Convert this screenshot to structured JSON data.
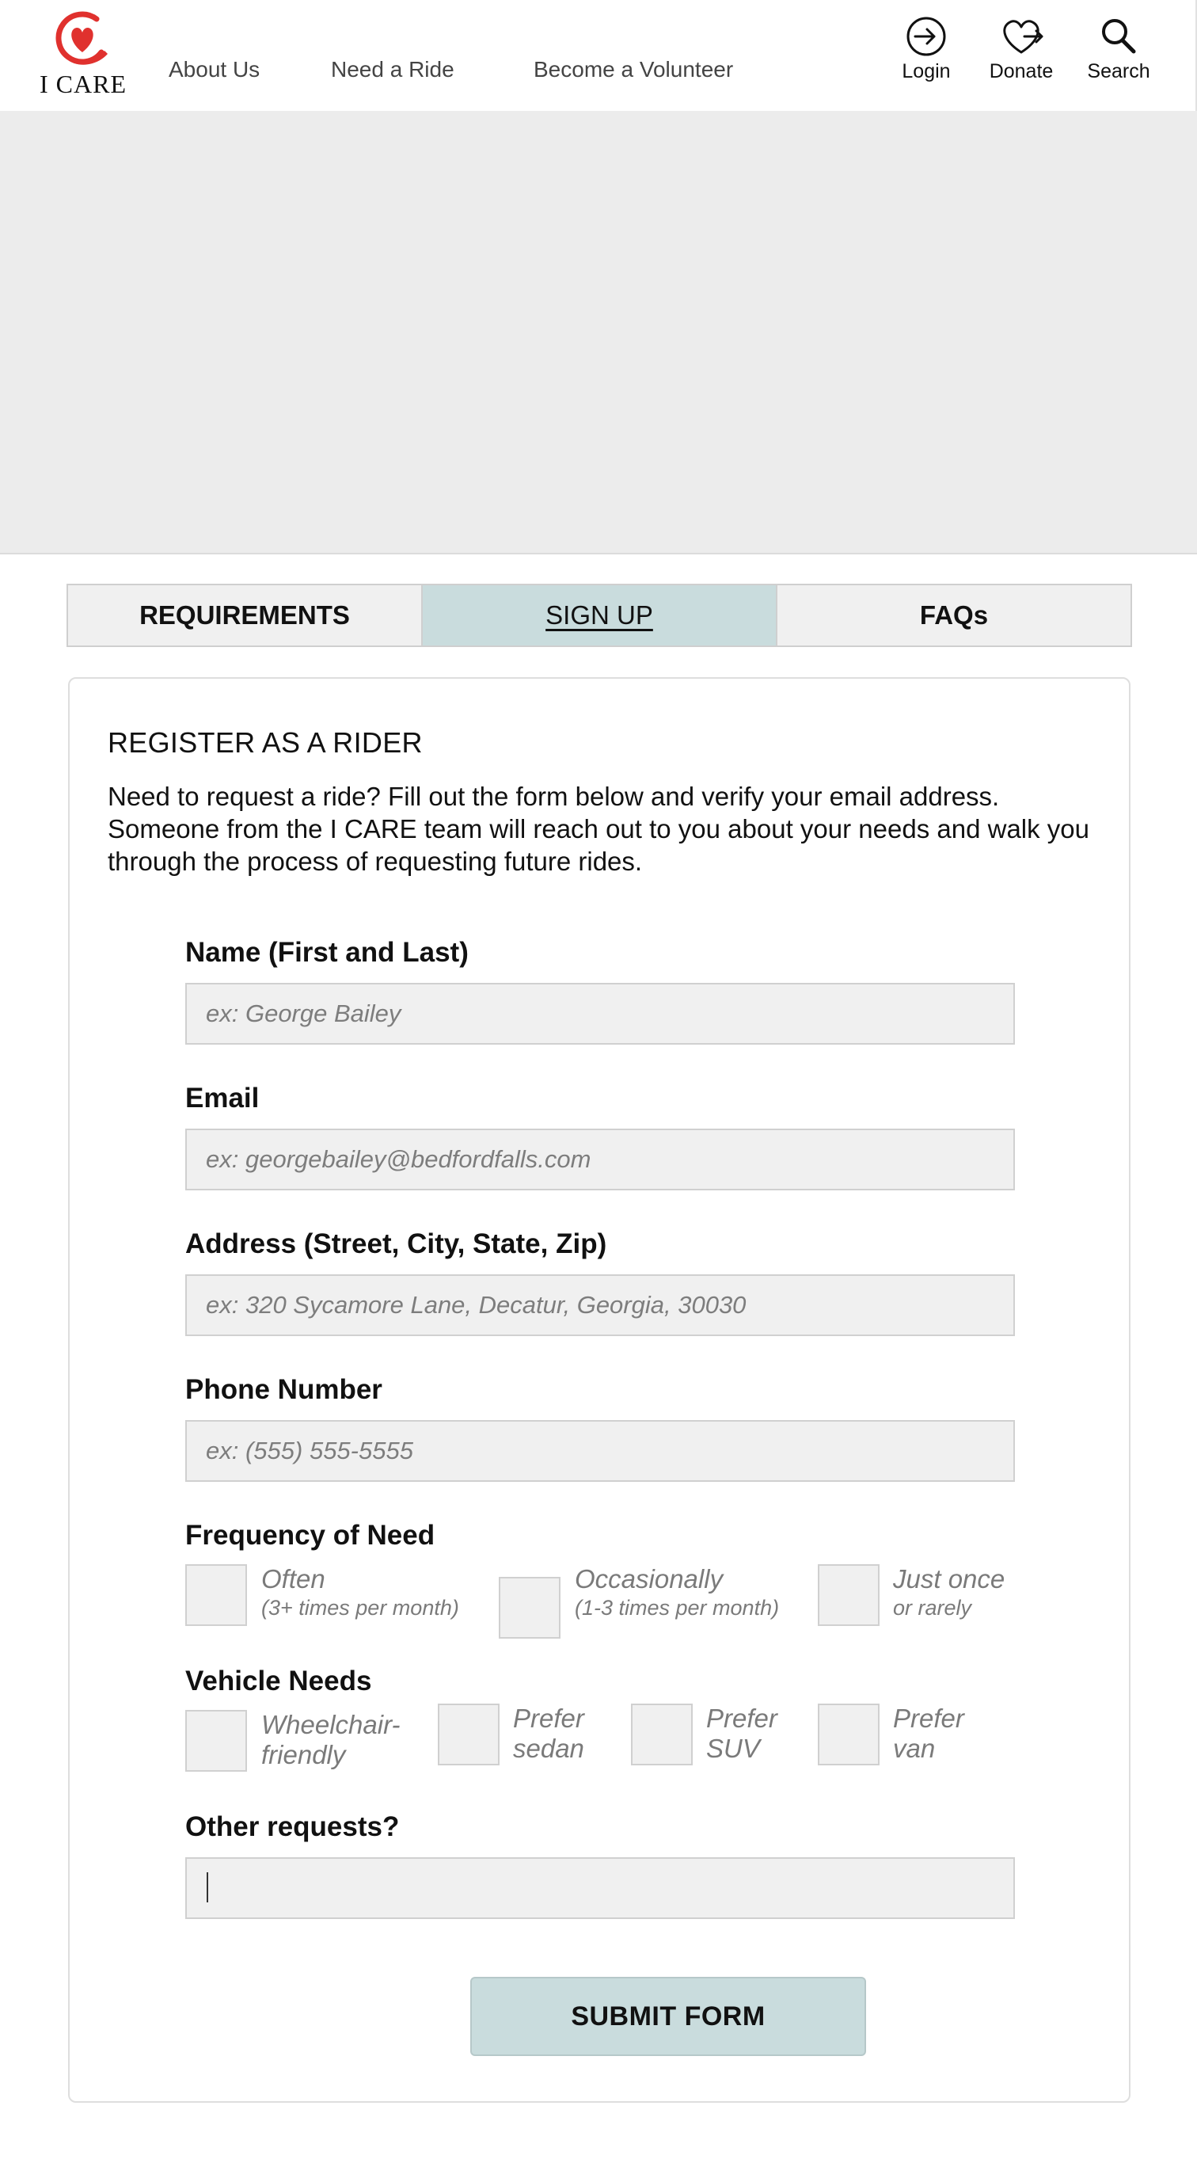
{
  "header": {
    "logo_text": "I CARE",
    "nav": [
      {
        "label": "About Us"
      },
      {
        "label": "Need a Ride"
      },
      {
        "label": "Become a Volunteer"
      }
    ],
    "utilities": {
      "login": "Login",
      "donate": "Donate",
      "search": "Search"
    },
    "brand_color": "#e0312e"
  },
  "tabs": [
    {
      "label": "REQUIREMENTS",
      "active": false
    },
    {
      "label": "SIGN UP",
      "active": true
    },
    {
      "label": "FAQs",
      "active": false
    }
  ],
  "form": {
    "title": "REGISTER AS A RIDER",
    "intro": "Need to request a ride?  Fill out the form below and verify your email address.  Someone from the I CARE team will reach out to you about your needs and walk you through the process of requesting future rides.",
    "name": {
      "label": "Name (First and Last)",
      "placeholder": "ex: George Bailey",
      "value": ""
    },
    "email": {
      "label": "Email",
      "placeholder": "ex: georgebailey@bedfordfalls.com",
      "value": ""
    },
    "address": {
      "label": "Address (Street, City, State, Zip)",
      "placeholder": "ex: 320 Sycamore Lane, Decatur, Georgia, 30030",
      "value": ""
    },
    "phone": {
      "label": "Phone Number",
      "placeholder": "ex: (555) 555-5555",
      "value": ""
    },
    "frequency": {
      "label": "Frequency of Need",
      "options": [
        {
          "main": "Often",
          "sub": "(3+ times per month)",
          "checked": false
        },
        {
          "main": "Occasionally",
          "sub": "(1-3 times per month)",
          "checked": false
        },
        {
          "main": "Just once",
          "sub": "or rarely",
          "checked": false
        }
      ]
    },
    "vehicle": {
      "label": "Vehicle Needs",
      "options": [
        {
          "line1": "Wheelchair-",
          "line2": "friendly",
          "checked": false
        },
        {
          "line1": "Prefer",
          "line2": "sedan",
          "checked": false
        },
        {
          "line1": "Prefer",
          "line2": "SUV",
          "checked": false
        },
        {
          "line1": "Prefer",
          "line2": "van",
          "checked": false
        }
      ]
    },
    "other": {
      "label": "Other requests?",
      "placeholder": "",
      "value": ""
    },
    "submit_label": "SUBMIT FORM"
  }
}
